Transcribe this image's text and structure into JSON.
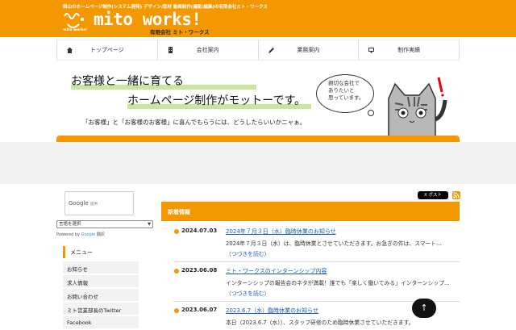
{
  "header": {
    "tagline": "岡山のホームページ制作(システム開発) デザイン/取材 動画制作(撮影/編集)の有限会社ミト・ワークス",
    "logo_text": "mito works!",
    "logo_sub": "mito works!",
    "company_name": "有限会社 ミト・ワークス",
    "brand_color": "#f39800"
  },
  "nav": {
    "items": [
      {
        "label": "トップページ",
        "icon": "home-icon"
      },
      {
        "label": "会社案内",
        "icon": "building-icon"
      },
      {
        "label": "業務案内",
        "icon": "pencil-icon"
      },
      {
        "label": "制作実績",
        "icon": "monitor-icon"
      }
    ]
  },
  "banner": {
    "line1": "お客様と一緒に育てる",
    "line2": "ホームページ制作がモットーです。",
    "sub": "「お客様」と「お客様のお客様」に喜んでもらうには、どうしたらいいかニャぁ。",
    "bubble_lines": [
      "親切な会社で",
      "ありたいと",
      "思っています。"
    ]
  },
  "sidebar": {
    "search_brand": "Google",
    "search_provided": "提供",
    "lang_select": "言語を選択",
    "powered_prefix": "Powered by",
    "powered_brand": "Google",
    "powered_suffix": "翻訳",
    "menu_title": "メニュー",
    "menu_items": [
      "お知らせ",
      "求人情報",
      "お問い合わせ",
      "ミト営業部長のTwitter",
      "Facebook"
    ]
  },
  "main": {
    "share_label": "X ポスト",
    "news_heading": "新着情報",
    "news": [
      {
        "date": "2024.07.03",
        "title": "2024年７月３日（水）臨時休業のお知らせ",
        "excerpt": "2024年７月３日（水）は、臨時休業とさせていただきます。お急ぎの件は、スマート…",
        "more": "（つづきを読む）"
      },
      {
        "date": "2023.06.08",
        "title": "ミト・ワークスのインターンシップ内容",
        "excerpt": "インターンシップの報告会のネタが満載！誰でも「楽しく働いてみる」インターンシップ…",
        "more": "（つづきを読む）"
      },
      {
        "date": "2023.06.07",
        "title": "2023.6.7（水）臨時休業のお知らせ",
        "excerpt": "本日（2023.6.7（水））、スタッフ研修のため臨時休業させていただきます。",
        "more": ""
      }
    ],
    "to_top": "↑"
  }
}
